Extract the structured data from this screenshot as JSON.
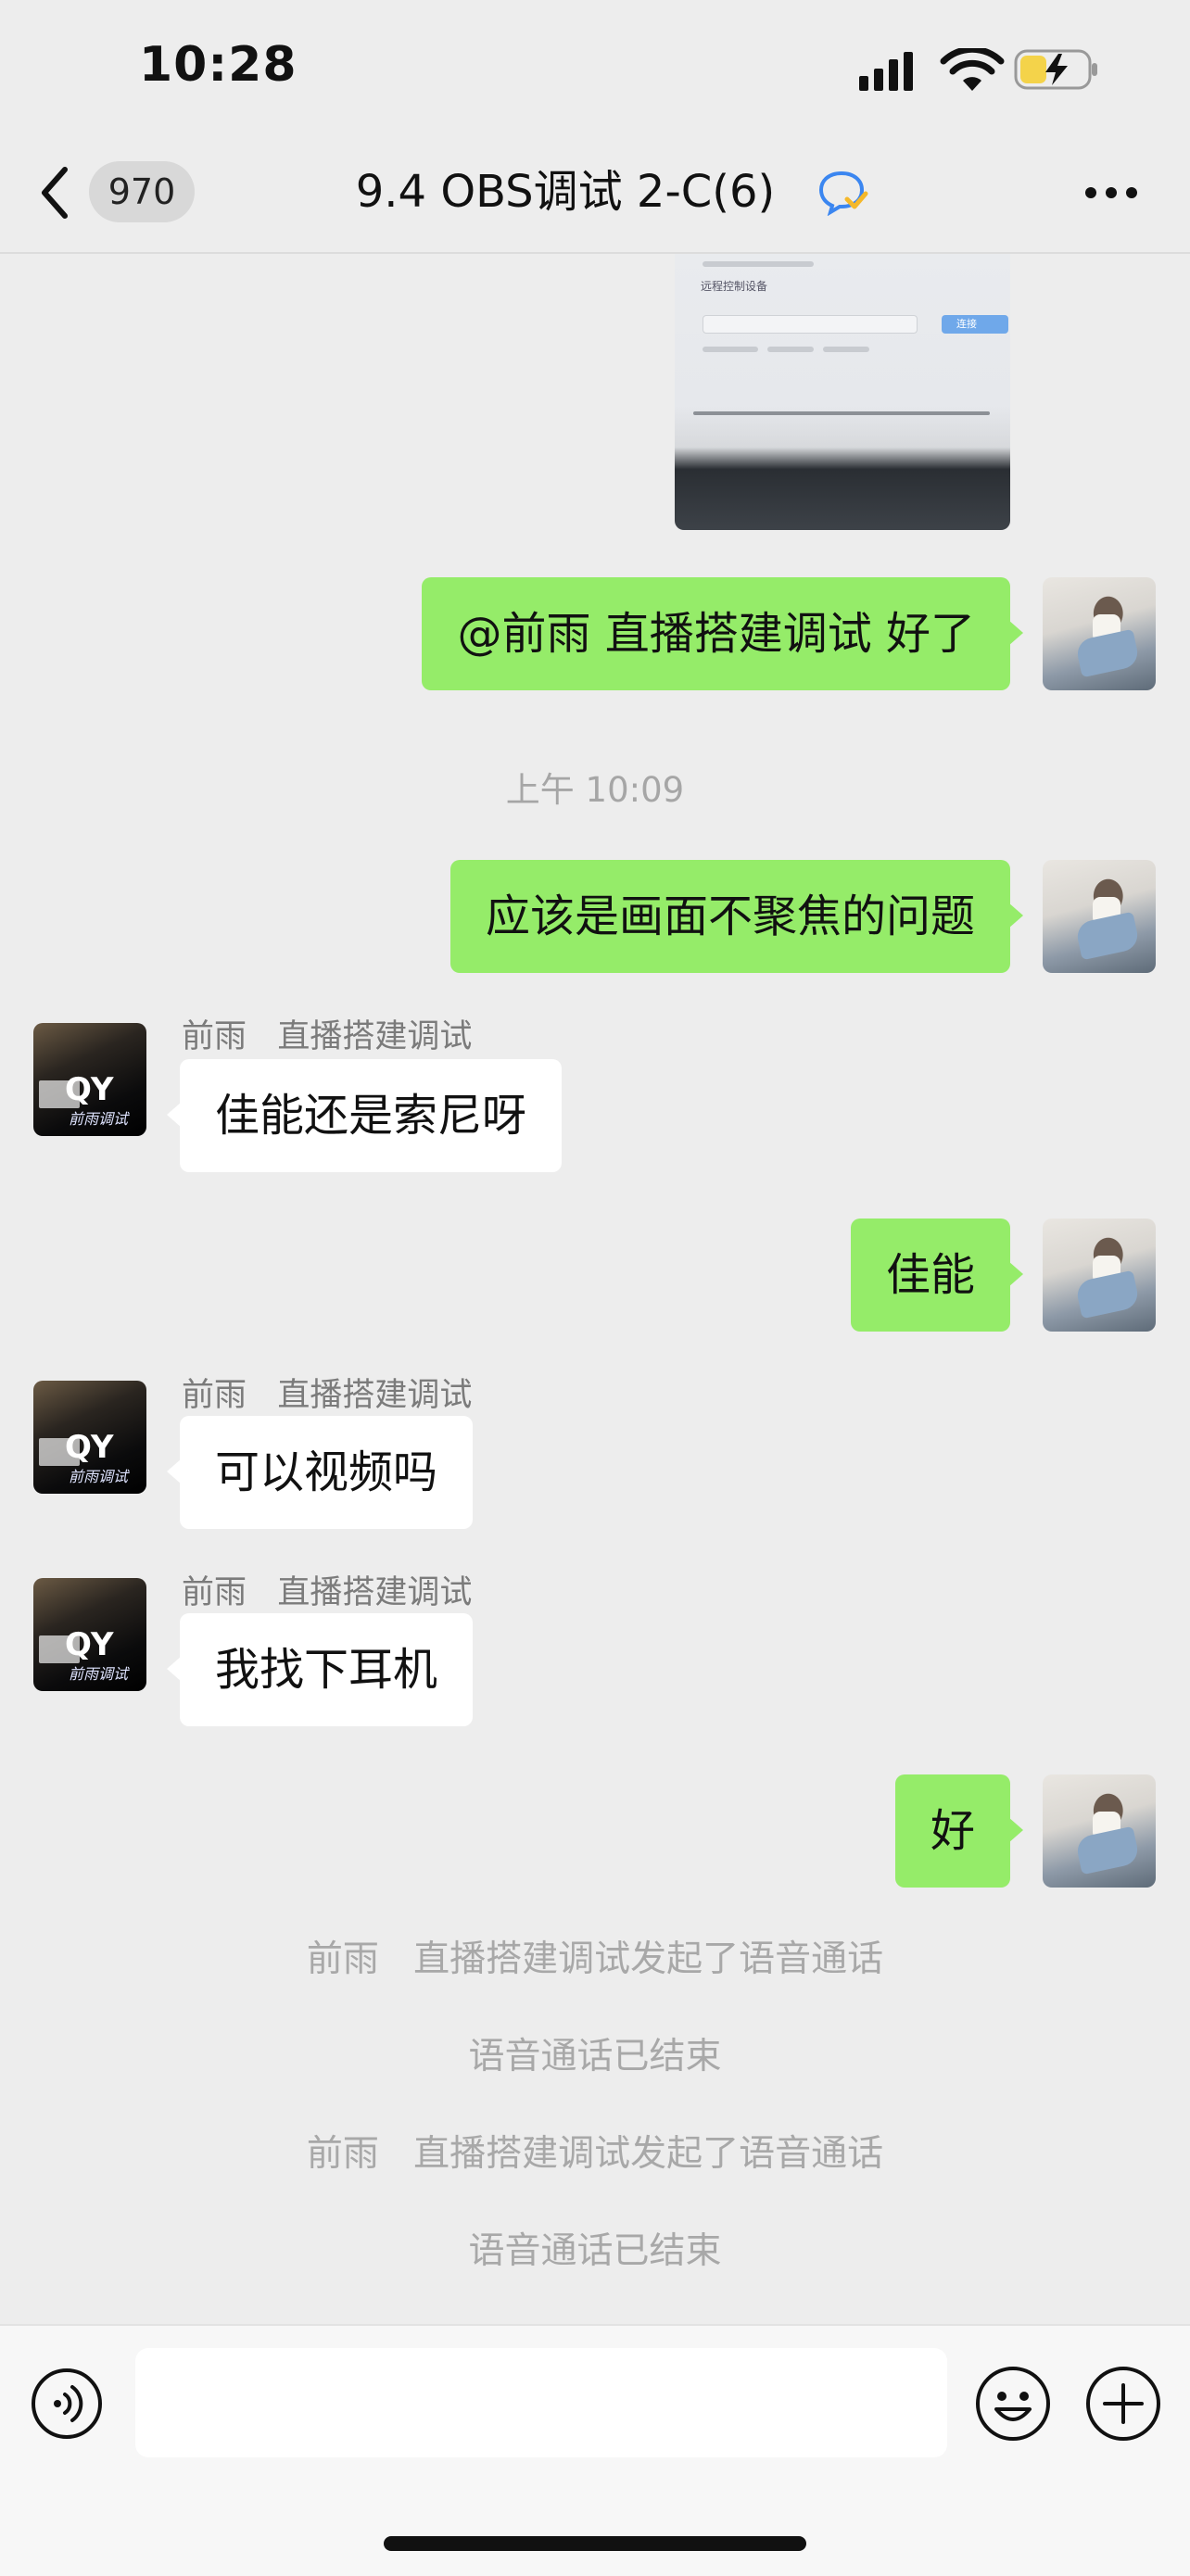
{
  "status_bar": {
    "time": "10:28"
  },
  "nav": {
    "back_count": "970",
    "title": "9.4 OBS调试 2-C(6)"
  },
  "messages": [
    {
      "from": "me",
      "text": "@前雨   直播搭建调试 好了"
    },
    {
      "type": "timestamp",
      "text": "上午 10:09"
    },
    {
      "from": "me",
      "text": "应该是画面不聚焦的问题"
    },
    {
      "from": "them",
      "sender": "前雨   直播搭建调试",
      "text": "佳能还是索尼呀"
    },
    {
      "from": "me",
      "text": "佳能"
    },
    {
      "from": "them",
      "sender": "前雨   直播搭建调试",
      "text": "可以视频吗"
    },
    {
      "from": "them",
      "sender": "前雨   直播搭建调试",
      "text": "我找下耳机"
    },
    {
      "from": "me",
      "text": "好"
    }
  ],
  "system_messages": [
    "前雨   直播搭建调试发起了语音通话",
    "语音通话已结束",
    "前雨   直播搭建调试发起了语音通话",
    "语音通话已结束"
  ],
  "avatar_logo": {
    "main": "QY",
    "sub": "前雨调试"
  },
  "photo_text": {
    "tag": "远程控制设备",
    "button": "连接"
  },
  "input": {
    "placeholder": ""
  },
  "colors": {
    "bubble_me": "#95ec69",
    "bubble_them": "#ffffff",
    "background": "#ededed",
    "battery": "#f4d34a"
  },
  "icons": [
    "back-icon",
    "signal-icon",
    "wifi-icon",
    "battery-icon",
    "verified-icon",
    "more-icon",
    "voice-icon",
    "emoji-icon",
    "plus-icon"
  ]
}
